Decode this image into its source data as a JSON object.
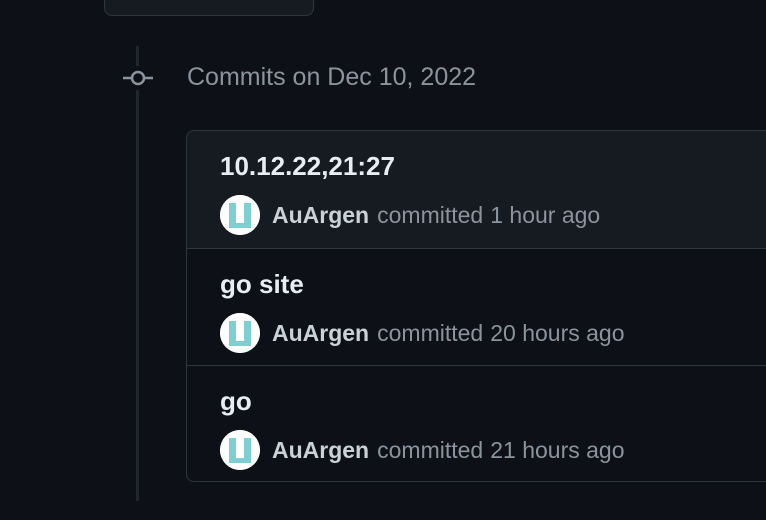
{
  "timeline": {
    "heading": "Commits on Dec 10, 2022",
    "icon": "git-commit-icon"
  },
  "commits": [
    {
      "message": "10.12.22,21:27",
      "author": "AuArgen",
      "verb": "committed",
      "time": "1 hour ago"
    },
    {
      "message": "go site",
      "author": "AuArgen",
      "verb": "committed",
      "time": "20 hours ago"
    },
    {
      "message": "go",
      "author": "AuArgen",
      "verb": "committed",
      "time": "21 hours ago"
    }
  ],
  "colors": {
    "background": "#0d1117",
    "border": "#30363d",
    "avatar_accent": "#7fcfd1",
    "text_primary": "#e6edf3",
    "text_muted": "#8b949e"
  }
}
